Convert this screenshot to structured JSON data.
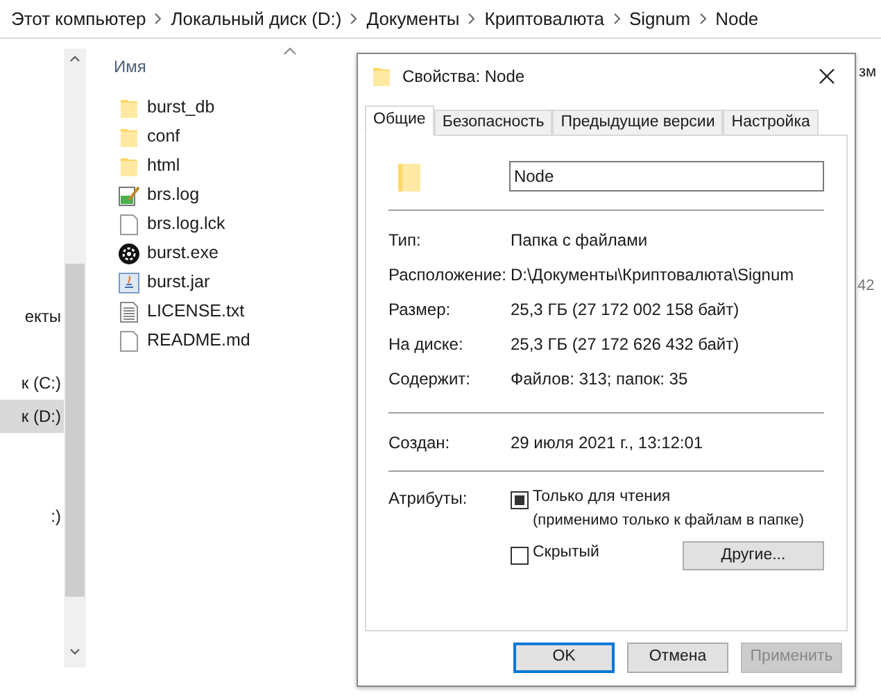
{
  "breadcrumb": [
    "Этот компьютер",
    "Локальный диск (D:)",
    "Документы",
    "Криптовалюта",
    "Signum",
    "Node"
  ],
  "nav_pane": {
    "items": [
      {
        "label": "екты",
        "selected": false
      },
      {
        "label": "к (C:)",
        "selected": false
      },
      {
        "label": "к (D:)",
        "selected": true
      },
      {
        "label": ":)",
        "selected": false
      }
    ]
  },
  "file_list": {
    "column_1_header": "Имя",
    "column_2_header": "зм",
    "column_2_cell": "42",
    "items": [
      {
        "name": "burst_db",
        "kind": "folder"
      },
      {
        "name": "conf",
        "kind": "folder"
      },
      {
        "name": "html",
        "kind": "folder"
      },
      {
        "name": "brs.log",
        "kind": "log"
      },
      {
        "name": "brs.log.lck",
        "kind": "file"
      },
      {
        "name": "burst.exe",
        "kind": "exe"
      },
      {
        "name": "burst.jar",
        "kind": "jar"
      },
      {
        "name": "LICENSE.txt",
        "kind": "text"
      },
      {
        "name": "README.md",
        "kind": "file"
      }
    ]
  },
  "dialog": {
    "title": "Свойства: Node",
    "tabs": [
      {
        "label": "Общие",
        "selected": true
      },
      {
        "label": "Безопасность",
        "selected": false
      },
      {
        "label": "Предыдущие версии",
        "selected": false
      },
      {
        "label": "Настройка",
        "selected": false
      }
    ],
    "name_field": {
      "value": "Node"
    },
    "property_groups": [
      [
        {
          "label": "Тип:",
          "value": "Папка с файлами"
        },
        {
          "label": "Расположение:",
          "value": "D:\\Документы\\Криптовалюта\\Signum"
        },
        {
          "label": "Размер:",
          "value": "25,3 ГБ (27 172 002 158 байт)"
        },
        {
          "label": "На диске:",
          "value": "25,3 ГБ (27 172 626 432 байт)"
        },
        {
          "label": "Содержит:",
          "value": "Файлов: 313; папок: 35"
        }
      ],
      [
        {
          "label": "Создан:",
          "value": "29 июля 2021 г., 13:12:01"
        }
      ]
    ],
    "attributes": {
      "label": "Атрибуты:",
      "checkboxes": [
        {
          "label": "Только для чтения",
          "note": "(применимо только к файлам в папке)",
          "checked": false,
          "indeterminate": true
        },
        {
          "label": "Скрытый",
          "checked": false,
          "indeterminate": false
        }
      ],
      "other_button": "Другие..."
    },
    "buttons": [
      {
        "label": "OK",
        "default": true,
        "disabled": false
      },
      {
        "label": "Отмена",
        "default": false,
        "disabled": false
      },
      {
        "label": "Применить",
        "default": false,
        "disabled": true
      }
    ]
  }
}
